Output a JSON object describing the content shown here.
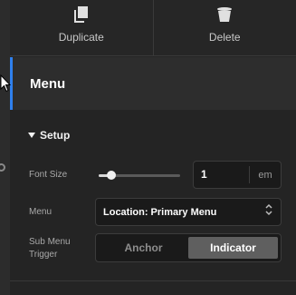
{
  "actions": {
    "duplicate": {
      "label": "Duplicate",
      "icon": "duplicate-icon"
    },
    "delete": {
      "label": "Delete",
      "icon": "trash-icon"
    }
  },
  "section": {
    "title": "Menu",
    "accent": "#2f80ed"
  },
  "setup": {
    "label": "Setup",
    "icon": "caret-down-icon"
  },
  "font_size": {
    "label": "Font Size",
    "value": "1",
    "unit": "em",
    "slider_fraction": 0.15
  },
  "menu": {
    "label": "Menu",
    "selected": "Location: Primary Menu",
    "icon": "updown-chevron-icon"
  },
  "sub_menu_trigger": {
    "label_line1": "Sub Menu",
    "label_line2": "Trigger",
    "options": [
      "Anchor",
      "Indicator"
    ],
    "selected": "Indicator"
  }
}
